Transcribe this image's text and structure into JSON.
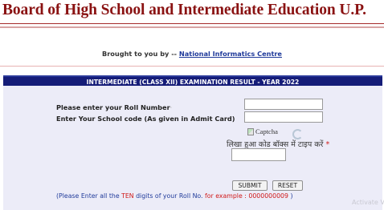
{
  "header": {
    "title": "Board of High School and Intermediate Education U.P."
  },
  "credit": {
    "prefix": "Brought to you by -- ",
    "link_text": "National Informatics Centre"
  },
  "banner": {
    "text": "INTERMEDIATE (CLASS XII)  EXAMINATION RESULT - YEAR 2022"
  },
  "form": {
    "roll_label": "Please enter your Roll Number",
    "roll_mark": "·",
    "roll_value": "",
    "school_label": "Enter Your School code (As given in Admit Card)",
    "school_value": "",
    "captcha_alt": "Captcha",
    "captcha_instruction": "लिखा हुआ कोड बॉक्स में टाइप करें",
    "required_mark": "*",
    "captcha_value": "",
    "submit_label": "SUBMIT",
    "reset_label": "RESET",
    "hint": {
      "part1": "(Please Enter all the ",
      "ten": "TEN",
      "part2": " digits of your Roll No. ",
      "example": "for example : 0000000009",
      "part3": " )"
    }
  },
  "watermark": "Activate V",
  "colors": {
    "title": "#8a1212",
    "banner_bg": "#151c78",
    "panel_bg": "#ececf8",
    "link": "#1f3a9a",
    "highlight": "#d01818"
  }
}
